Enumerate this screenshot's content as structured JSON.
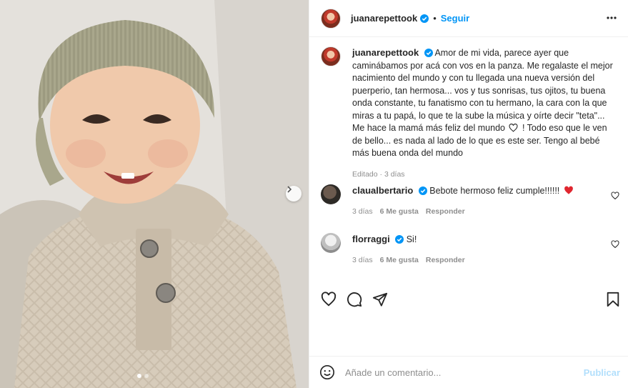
{
  "post": {
    "author": "juanarepettook",
    "follow_label": "Seguir",
    "separator": "•",
    "caption": "Amor de mi vida, parece ayer que caminábamos por acá con vos en la panza. Me regalaste el mejor nacimiento del mundo y con tu llegada una nueva versión del puerperio, tan hermosa... vos y tus sonrisas, tus ojitos, tu buena onda constante, tu fanatismo con tu hermano, la cara con la que miras a tu papá, lo que te la sube la música y oírte decir \"teta\"... Me hace la mamá más feliz del mundo",
    "caption_tail": "! Todo eso que le ven de bello... es nada al lado de lo que es este ser. Tengo al bebé más buena onda del mundo",
    "caption_meta": "Editado · 3 días"
  },
  "comments": [
    {
      "user": "claualbertario",
      "text": "Bebote hermoso feliz cumple!!!!!!",
      "age": "3 días",
      "likes": "6 Me gusta",
      "reply": "Responder"
    },
    {
      "user": "florraggi",
      "text": "Si!",
      "age": "3 días",
      "likes": "6 Me gusta",
      "reply": "Responder"
    }
  ],
  "composer": {
    "placeholder": "Añade un comentario...",
    "publish_label": "Publicar"
  },
  "colors": {
    "accent": "#0095f6",
    "verified": "#0095f6",
    "heart": "#ed4956",
    "muted": "#8e8e8e"
  },
  "icons": [
    "verified-icon",
    "more-icon",
    "heart-icon",
    "comment-icon",
    "share-icon",
    "save-icon",
    "emoji-icon",
    "next-arrow-icon"
  ]
}
